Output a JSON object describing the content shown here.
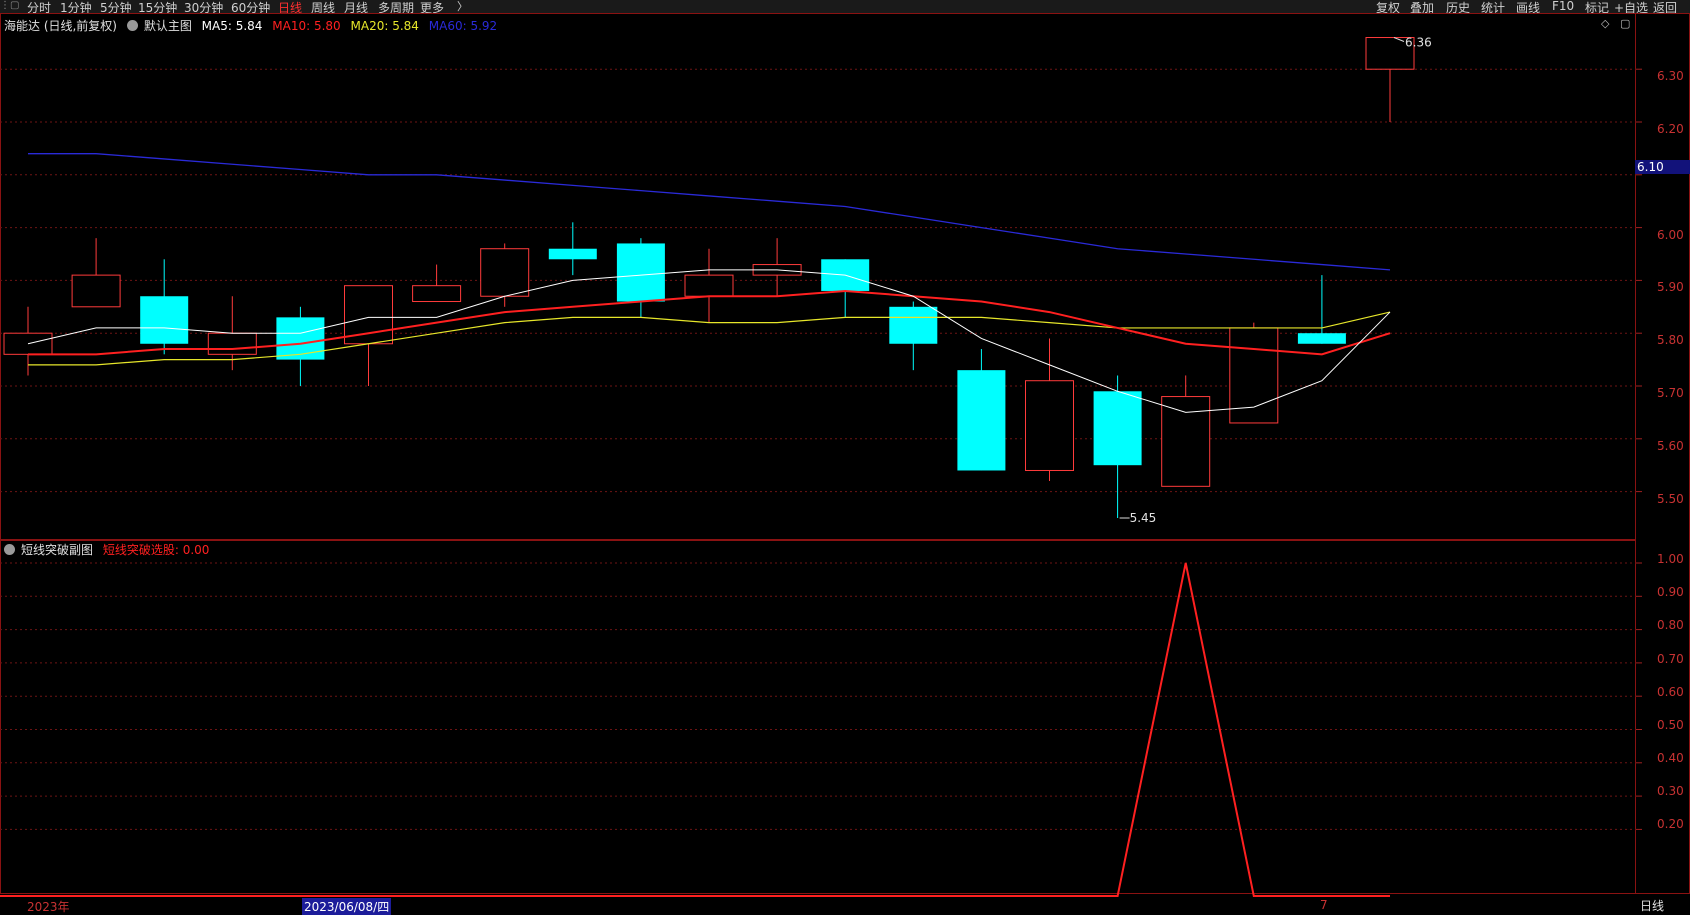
{
  "toolbar": {
    "grip": "⋮▢",
    "periods": [
      "分时",
      "1分钟",
      "5分钟",
      "15分钟",
      "30分钟",
      "60分钟",
      "日线",
      "周线",
      "月线",
      "多周期",
      "更多"
    ],
    "more_arrow": "〉",
    "tools": [
      "复权",
      "叠加",
      "历史",
      "统计",
      "画线",
      "F10",
      "标记",
      "+自选",
      "返回"
    ]
  },
  "main_legend": {
    "stock": "海能达 (日线,前复权)",
    "template": "默认主图",
    "ma5": "MA5: 5.84",
    "ma10": "MA10: 5.80",
    "ma20": "MA20: 5.84",
    "ma60": "MA60: 5.92"
  },
  "sub_legend": {
    "name": "短线突破副图",
    "value": "短线突破选股: 0.00"
  },
  "price_axis": [
    "6.30",
    "6.20",
    "6.10",
    "6.00",
    "5.90",
    "5.80",
    "5.70",
    "5.60",
    "5.50"
  ],
  "current_price_flag": "6.10",
  "sub_axis": [
    "1.00",
    "0.90",
    "0.80",
    "0.70",
    "0.60",
    "0.50",
    "0.40",
    "0.30",
    "0.20"
  ],
  "annotations": {
    "high": "6.36",
    "low": "5.45"
  },
  "dates": {
    "year": "2023年",
    "selected": "2023/06/08/四",
    "month": "7"
  },
  "period_tag": "日线",
  "colors": {
    "up": "#ff3b3b",
    "down": "#00ffff",
    "ma5": "#ffffff",
    "ma10": "#ff2020",
    "ma20": "#e6e62a",
    "ma60": "#2a2ad8",
    "grid": "#6e1414"
  },
  "chart_data": {
    "type": "candlestick",
    "ylim": [
      5.4,
      6.4
    ],
    "candles": [
      {
        "o": 5.76,
        "c": 5.8,
        "h": 5.85,
        "l": 5.72
      },
      {
        "o": 5.85,
        "c": 5.91,
        "h": 5.98,
        "l": 5.85
      },
      {
        "o": 5.87,
        "c": 5.78,
        "h": 5.94,
        "l": 5.76
      },
      {
        "o": 5.76,
        "c": 5.8,
        "h": 5.87,
        "l": 5.73
      },
      {
        "o": 5.83,
        "c": 5.75,
        "h": 5.85,
        "l": 5.7
      },
      {
        "o": 5.78,
        "c": 5.89,
        "h": 5.89,
        "l": 5.7
      },
      {
        "o": 5.86,
        "c": 5.89,
        "h": 5.93,
        "l": 5.86
      },
      {
        "o": 5.87,
        "c": 5.96,
        "h": 5.97,
        "l": 5.85
      },
      {
        "o": 5.96,
        "c": 5.94,
        "h": 6.01,
        "l": 5.91
      },
      {
        "o": 5.97,
        "c": 5.86,
        "h": 5.98,
        "l": 5.83
      },
      {
        "o": 5.87,
        "c": 5.91,
        "h": 5.96,
        "l": 5.82
      },
      {
        "o": 5.91,
        "c": 5.93,
        "h": 5.98,
        "l": 5.87
      },
      {
        "o": 5.94,
        "c": 5.88,
        "h": 5.94,
        "l": 5.83
      },
      {
        "o": 5.85,
        "c": 5.78,
        "h": 5.86,
        "l": 5.73
      },
      {
        "o": 5.73,
        "c": 5.54,
        "h": 5.77,
        "l": 5.54
      },
      {
        "o": 5.54,
        "c": 5.71,
        "h": 5.79,
        "l": 5.52
      },
      {
        "o": 5.69,
        "c": 5.55,
        "h": 5.72,
        "l": 5.45
      },
      {
        "o": 5.51,
        "c": 5.68,
        "h": 5.72,
        "l": 5.51
      },
      {
        "o": 5.63,
        "c": 5.81,
        "h": 5.82,
        "l": 5.63
      },
      {
        "o": 5.8,
        "c": 5.78,
        "h": 5.91,
        "l": 5.78
      },
      {
        "o": 6.3,
        "c": 6.36,
        "h": 6.36,
        "l": 6.2
      }
    ],
    "ma5": [
      5.78,
      5.81,
      5.81,
      5.8,
      5.8,
      5.83,
      5.83,
      5.87,
      5.9,
      5.91,
      5.92,
      5.92,
      5.91,
      5.87,
      5.79,
      5.74,
      5.69,
      5.65,
      5.66,
      5.71,
      5.84
    ],
    "ma10": [
      5.76,
      5.76,
      5.77,
      5.77,
      5.78,
      5.8,
      5.82,
      5.84,
      5.85,
      5.86,
      5.87,
      5.87,
      5.88,
      5.87,
      5.86,
      5.84,
      5.81,
      5.78,
      5.77,
      5.76,
      5.8
    ],
    "ma20": [
      5.74,
      5.74,
      5.75,
      5.75,
      5.76,
      5.78,
      5.8,
      5.82,
      5.83,
      5.83,
      5.82,
      5.82,
      5.83,
      5.83,
      5.83,
      5.82,
      5.81,
      5.81,
      5.81,
      5.81,
      5.84
    ],
    "ma60": [
      6.14,
      6.14,
      6.13,
      6.12,
      6.11,
      6.1,
      6.1,
      6.09,
      6.08,
      6.07,
      6.06,
      6.05,
      6.04,
      6.02,
      6.0,
      5.98,
      5.96,
      5.95,
      5.94,
      5.93,
      5.92
    ],
    "indicator": {
      "name": "短线突破选股",
      "ylim": [
        0,
        1
      ],
      "values": [
        0,
        0,
        0,
        0,
        0,
        0,
        0,
        0,
        0,
        0,
        0,
        0,
        0,
        0,
        0,
        0,
        0,
        1,
        0,
        0,
        0
      ]
    }
  }
}
